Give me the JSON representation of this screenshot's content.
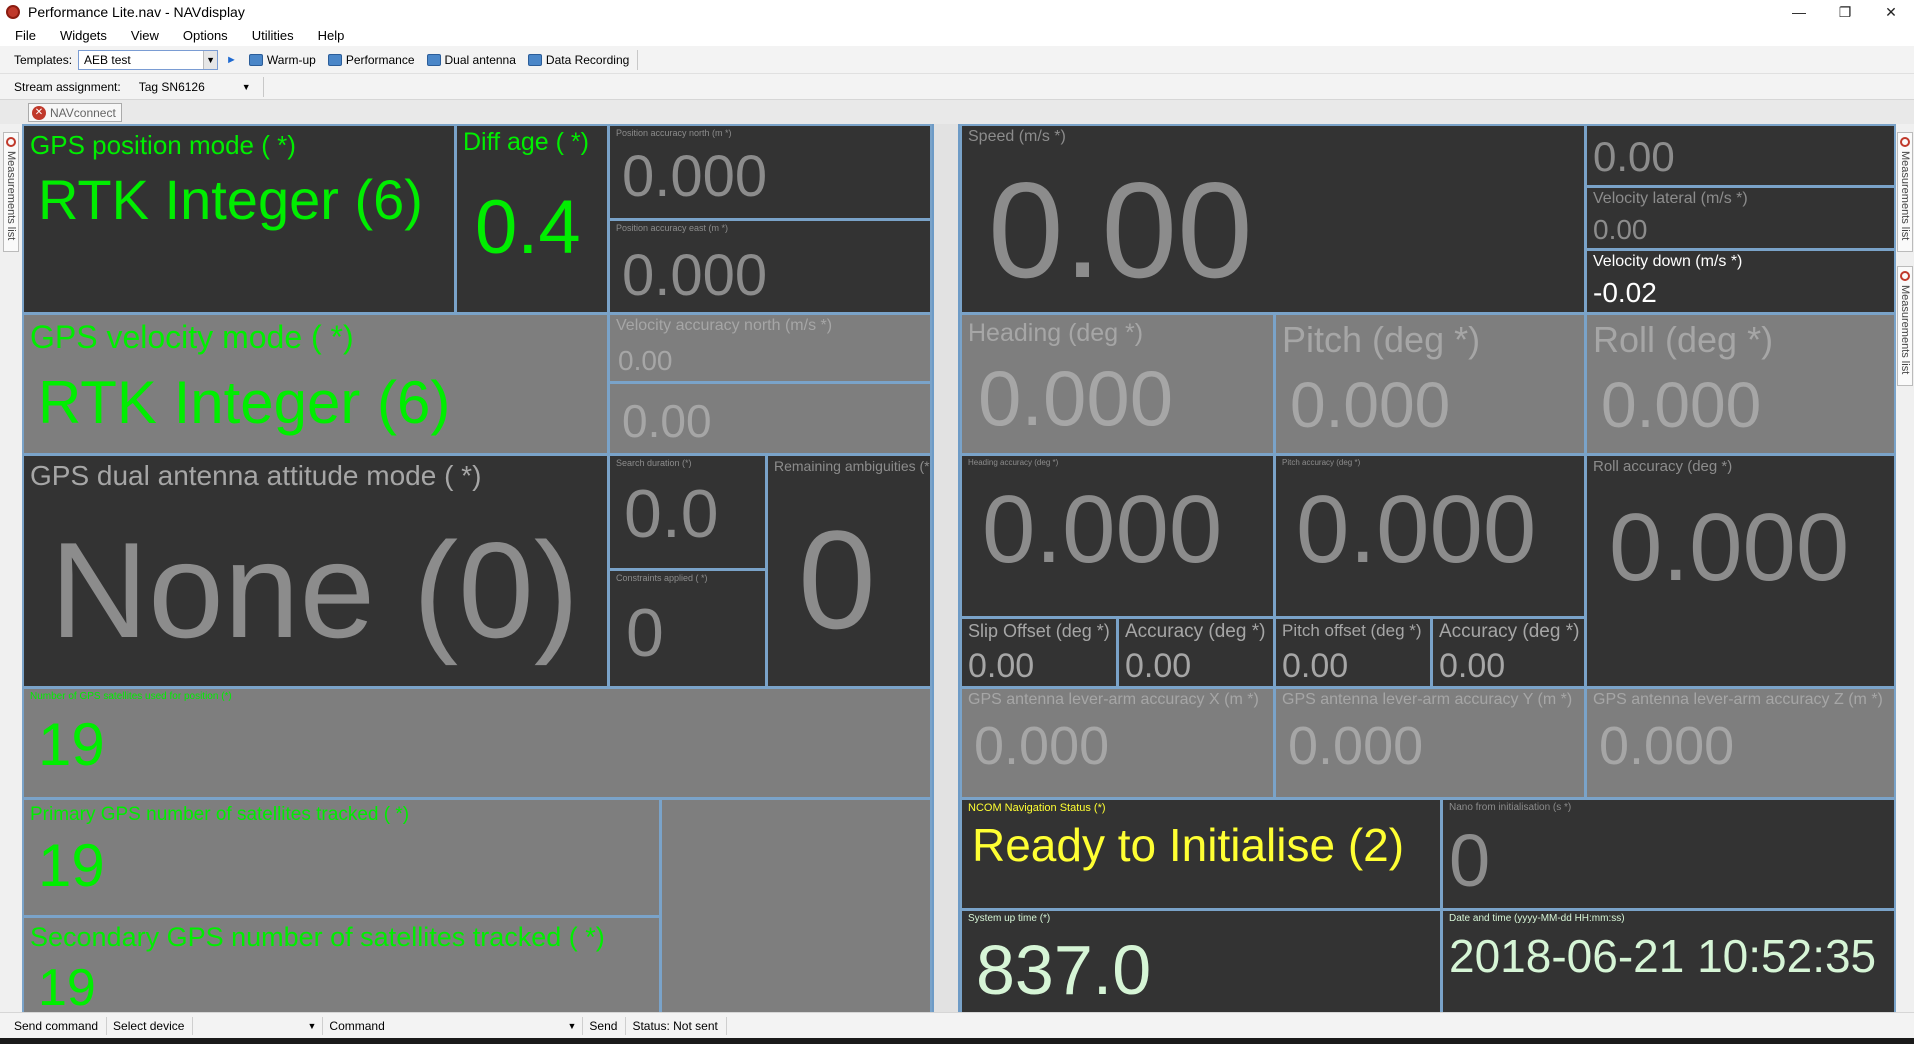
{
  "window": {
    "title": "Performance Lite.nav - NAVdisplay",
    "minimize": "—",
    "restore": "❐",
    "close": "✕"
  },
  "menu": [
    "File",
    "Widgets",
    "View",
    "Options",
    "Utilities",
    "Help"
  ],
  "toolbar": {
    "templates_label": "Templates:",
    "template_value": "AEB test",
    "buttons": [
      "Warm-up",
      "Performance",
      "Dual antenna",
      "Data Recording"
    ]
  },
  "stream": {
    "label": "Stream assignment:",
    "value": "Tag SN6126"
  },
  "connect_tab": "NAVconnect",
  "side_tabs": {
    "left": "Measurements list",
    "right1": "Measurements list",
    "right2": "Measurements list"
  },
  "widgets": {
    "gps_pos_mode": {
      "label": "GPS position mode ( *)",
      "value": "RTK Integer (6)"
    },
    "diff_age": {
      "label": "Diff age ( *)",
      "value": "0.4"
    },
    "pos_acc_north": {
      "label": "Position accuracy north (m *)",
      "value": "0.000"
    },
    "pos_acc_east": {
      "label": "Position accuracy east (m *)",
      "value": "0.000"
    },
    "gps_vel_mode": {
      "label": "GPS velocity mode ( *)",
      "value": "RTK Integer (6)"
    },
    "vel_acc_north": {
      "label": "Velocity accuracy north (m/s *)",
      "value": "0.00"
    },
    "vel_acc_east": {
      "label": "",
      "value": "0.00"
    },
    "dual_ant_mode": {
      "label": "GPS dual antenna attitude mode ( *)",
      "value": "None (0)"
    },
    "search_duration": {
      "label": "Search duration (*)",
      "value": "0.0"
    },
    "constraints_applied": {
      "label": "Constraints applied ( *)",
      "value": "0"
    },
    "remaining_ambiguities": {
      "label": "Remaining ambiguities (*",
      "value": "0"
    },
    "num_sats_pos": {
      "label": "Number of GPS satellites used for position (*)",
      "value": "19"
    },
    "primary_sats": {
      "label": "Primary GPS number of satellites tracked ( *)",
      "value": "19"
    },
    "secondary_sats": {
      "label": "Secondary GPS number of satellites tracked ( *)",
      "value": "19"
    },
    "speed": {
      "label": "Speed (m/s *)",
      "value": "0.00"
    },
    "vel_forward": {
      "label": "",
      "value": "0.00"
    },
    "vel_lateral": {
      "label": "Velocity lateral (m/s *)",
      "value": "0.00"
    },
    "vel_down": {
      "label": "Velocity down (m/s *)",
      "value": "-0.02"
    },
    "heading": {
      "label": "Heading (deg *)",
      "value": "0.000"
    },
    "pitch": {
      "label": "Pitch (deg *)",
      "value": "0.000"
    },
    "roll": {
      "label": "Roll (deg *)",
      "value": "0.000"
    },
    "heading_acc": {
      "label": "Heading accuracy (deg *)",
      "value": "0.000"
    },
    "pitch_acc": {
      "label": "Pitch accuracy (deg *)",
      "value": "0.000"
    },
    "roll_acc": {
      "label": "Roll accuracy (deg *)",
      "value": "0.000"
    },
    "slip_offset": {
      "label": "Slip Offset (deg *)",
      "value": "0.00"
    },
    "slip_acc": {
      "label": "Accuracy (deg *)",
      "value": "0.00"
    },
    "pitch_offset": {
      "label": "Pitch offset (deg *)",
      "value": "0.00"
    },
    "pitch_offset_acc": {
      "label": "Accuracy (deg *)",
      "value": "0.00"
    },
    "lever_x": {
      "label": "GPS antenna lever-arm accuracy X (m *)",
      "value": "0.000"
    },
    "lever_y": {
      "label": "GPS antenna lever-arm accuracy Y (m *)",
      "value": "0.000"
    },
    "lever_z": {
      "label": "GPS antenna lever-arm accuracy Z (m *)",
      "value": "0.000"
    },
    "ncom_status": {
      "label": "NCOM Navigation Status (*)",
      "value": "Ready to Initialise (2)"
    },
    "nano_init": {
      "label": "Nano from initialisation (s *)",
      "value": "0"
    },
    "system_up": {
      "label": "System up time (*)",
      "value": "837.0"
    },
    "datetime": {
      "label": "Date and time (yyyy-MM-dd HH:mm:ss)",
      "value": "2018-06-21 10:52:35"
    }
  },
  "statusbar": {
    "send_command": "Send command",
    "select_device": "Select device",
    "command": "Command",
    "send": "Send",
    "status": "Status: Not sent"
  },
  "colors": {
    "accent_green": "#00ee00",
    "status_yellow": "#ffff33",
    "panel_dark": "#333333",
    "panel_grey": "#7e7e7e",
    "border_blue": "#6e9bc6"
  }
}
